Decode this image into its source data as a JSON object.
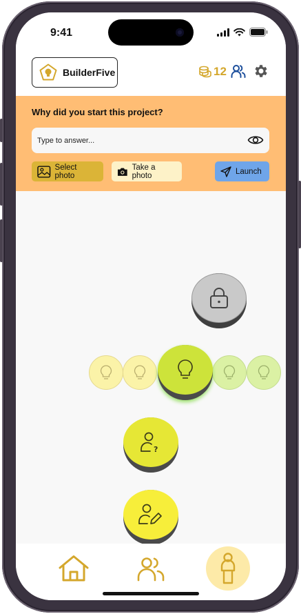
{
  "status_bar": {
    "time": "9:41"
  },
  "header": {
    "app_name": "BuilderFive",
    "coins": "12"
  },
  "question": {
    "title": "Why did you start this project?",
    "placeholder": "Type to answer...",
    "select_photo_label": "Select photo",
    "take_photo_label": "Take a photo",
    "launch_label": "Launch"
  },
  "path": {
    "nodes": [
      {
        "name": "locked-node",
        "icon": "lock-icon",
        "state": "locked"
      },
      {
        "name": "lightbulb-node-current",
        "icon": "lightbulb-icon",
        "state": "current"
      },
      {
        "name": "person-question-node",
        "icon": "person-question-icon",
        "state": "available"
      },
      {
        "name": "person-edit-node",
        "icon": "person-edit-icon",
        "state": "available"
      }
    ],
    "carousel": [
      "lightbulb-icon",
      "lightbulb-icon",
      "lightbulb-icon",
      "lightbulb-icon",
      "lightbulb-icon"
    ]
  },
  "bottom_nav": {
    "items": [
      {
        "name": "home",
        "icon": "home-icon",
        "active": false
      },
      {
        "name": "team",
        "icon": "users-icon",
        "active": false
      },
      {
        "name": "profile",
        "icon": "person-icon",
        "active": true
      }
    ]
  },
  "colors": {
    "accent": "#d4a72c",
    "panel": "#ffbd74",
    "launch": "#6fa5e9",
    "node_green": "#cde33a",
    "node_yellow": "#f7ee3a",
    "locked": "#c8c8c8"
  }
}
